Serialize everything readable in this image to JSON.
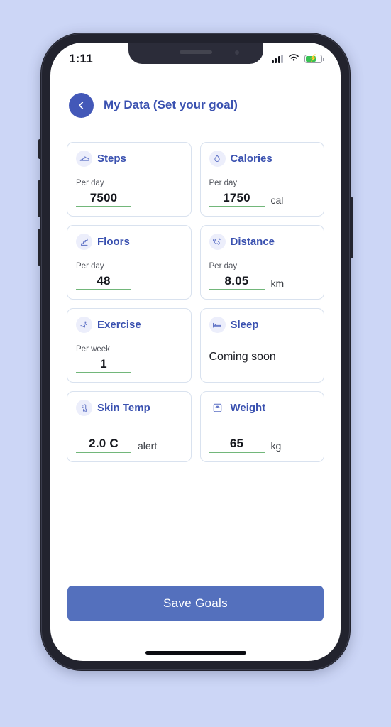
{
  "status_bar": {
    "time": "1:11",
    "signal_icon": "signal-bars-icon",
    "wifi_icon": "wifi-icon",
    "battery_icon": "battery-charging-icon"
  },
  "header": {
    "back_icon": "chevron-left-icon",
    "title": "My Data (Set your goal)"
  },
  "cards": [
    {
      "id": "steps",
      "icon": "shoe-icon",
      "title": "Steps",
      "period": "Per day",
      "value": "7500",
      "unit": ""
    },
    {
      "id": "calories",
      "icon": "flame-drop-icon",
      "title": "Calories",
      "period": "Per day",
      "value": "1750",
      "unit": "cal"
    },
    {
      "id": "floors",
      "icon": "stairs-icon",
      "title": "Floors",
      "period": "Per day",
      "value": "48",
      "unit": ""
    },
    {
      "id": "distance",
      "icon": "route-icon",
      "title": "Distance",
      "period": "Per day",
      "value": "8.05",
      "unit": "km"
    },
    {
      "id": "exercise",
      "icon": "running-person-icon",
      "title": "Exercise",
      "period": "Per week",
      "value": "1",
      "unit": ""
    },
    {
      "id": "sleep",
      "icon": "bed-icon",
      "title": "Sleep",
      "period": "",
      "value": "",
      "unit": "",
      "placeholder_text": "Coming soon"
    },
    {
      "id": "skin-temp",
      "icon": "thermometer-icon",
      "title": "Skin Temp",
      "period": "",
      "value": "2.0 C",
      "unit": "alert"
    },
    {
      "id": "weight",
      "icon": "scale-icon",
      "title": "Weight",
      "period": "",
      "value": "65",
      "unit": "kg"
    }
  ],
  "save_button": {
    "label": "Save Goals"
  },
  "colors": {
    "page_background": "#ccd6f6",
    "accent_blue": "#3a51b0",
    "button_blue": "#5470bd",
    "underline_green": "#72b77a",
    "card_border": "#d9e2ef"
  }
}
